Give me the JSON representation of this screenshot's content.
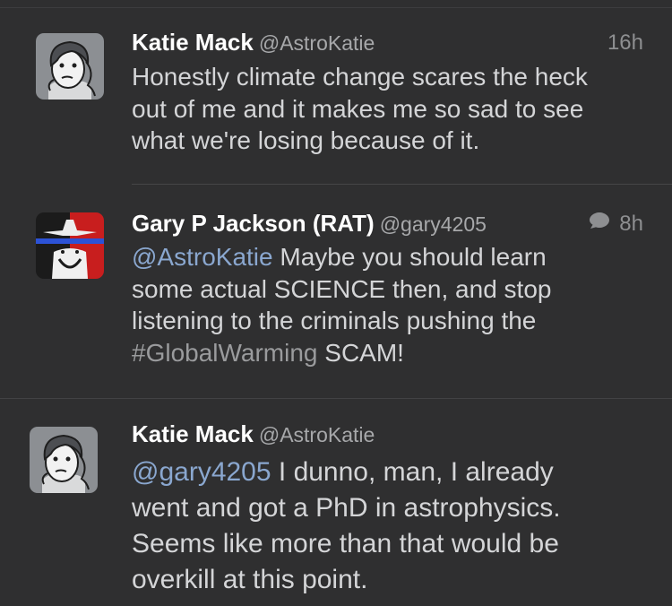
{
  "timeline": {
    "tweets": [
      {
        "name": "Katie Mack",
        "handle": "@AstroKatie",
        "time": "16h",
        "text": "Honestly climate change scares the heck\nout of me and it makes me so sad to see\nwhat we're losing because of it."
      },
      {
        "name": "Gary P Jackson (RAT)",
        "handle": "@gary4205",
        "time": "8h",
        "reply_icon": "speech-bubble-icon",
        "mention": "@AstroKatie",
        "text_a": " Maybe you should learn\nsome actual SCIENCE then, and stop\nlistening to the criminals pushing the\n",
        "hashtag": "#GlobalWarming",
        "text_b": " SCAM!"
      },
      {
        "name": "Katie Mack",
        "handle": "@AstroKatie",
        "mention": "@gary4205",
        "text": " I dunno, man, I already\nwent and got a PhD in astrophysics.\nSeems like more than that would be\noverkill at this point."
      }
    ]
  },
  "colors": {
    "background": "#2f2f30",
    "name": "#ffffff",
    "text": "#d4d5d7",
    "mention": "#8aa7cf",
    "hashtag": "#9a9b9d"
  }
}
